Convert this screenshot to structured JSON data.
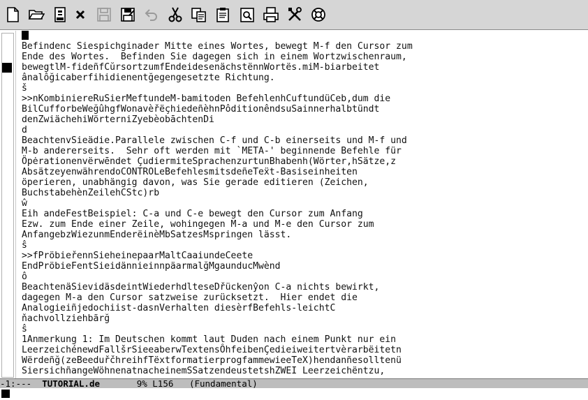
{
  "toolbar": {
    "buttons": [
      {
        "name": "new-file-button",
        "icon": "new-file-icon"
      },
      {
        "name": "open-file-button",
        "icon": "folder-open-icon"
      },
      {
        "name": "open-directory-button",
        "icon": "directory-icon"
      },
      {
        "name": "close-buffer-button",
        "icon": "close-icon"
      },
      {
        "name": "save-button",
        "icon": "floppy-disk-icon"
      },
      {
        "name": "save-as-button",
        "icon": "floppy-disk-pencil-icon"
      },
      {
        "name": "undo-button",
        "icon": "undo-icon"
      },
      {
        "name": "cut-button",
        "icon": "scissors-icon"
      },
      {
        "name": "copy-button",
        "icon": "copy-icon"
      },
      {
        "name": "paste-button",
        "icon": "paste-icon"
      },
      {
        "name": "search-button",
        "icon": "search-icon"
      },
      {
        "name": "print-button",
        "icon": "printer-icon"
      },
      {
        "name": "preferences-button",
        "icon": "tools-icon"
      },
      {
        "name": "help-button",
        "icon": "lifebuoy-icon"
      }
    ]
  },
  "buffer": {
    "lines": [
      "",
      "Befindenc Siespichginader Mitte eines Wortes, bewegt M-f den Cursor zum",
      "Ende des Wortes.  Befinden Sie dagegen sich in einem Wortzwischenraum,",
      "bewegtlM-fideñfCŭrsortzumfEndeidesenächstënnWortës.miM-biarbeitet",
      "ânalôğicaberfihidienentğegengesetzte Richtung.",
      "š",
      ">>nKombiniereRuSierMeftundeM-bamitoden BefehlenhCuftundüCeb,dum die",
      "BilCufforbeWeğûhgfWonavèřëçhiedeñèhnPôditionêndsuSainnerhalbtündt",
      "denZwiächehiWörterniZyebèobāchtenDi",
      "d",
      "BeachtenvSieädie.Parallele zwischen C-f und C-b einerseits und M-f und",
      "M-b andererseits.  Sehr oft werden mit `META-' beginnende Befehle für",
      "Öpėrationenvërwēndet ÇudiermiteSprachenzurtunBhabenh(Wörter,hSätze,z",
      "AbsätzeyenwährendoCONTROLeBefehlesmitsdeñeTeẍt-Basiseinheiten",
      "öperieren, unabhängig davon, was Sie gerade editieren (Zeichen,",
      "BuchstabehènZeilehCStc)rb",
      "ŵ",
      "Eih andeFestBeispiel: C-a und C-e bewegt den Cursor zum Anfang",
      "Ezw. zum Ende einer Zeile, wohingegen M-a und M-e den Cursor zum",
      "AnfangebzWiezunmEnderëinèMbSatzesMspringen lässt.",
      "ŝ",
      ">>fPröbieřennSieheinepaarMaltCaaiundeCeete",
      "EndPröbieFentSieidännieinnpäarmalğMgaunducMwènd",
      "ô",
      "BeachtenäSievidäsdeintWiederhdlteseDřückenŷon C-a nichts bewirkt,",
      "dagegen M-a den Cursor satzweise zurücksetzt.  Hier endet die",
      "Analogieiñjedochiist-dasnVerhalten diesèrfBefehls-leichtC",
      "ňachvollziehbãrğ",
      "ŝ",
      "1Anmerkung 1: Im Deutschen kommt laut Duden nach einem Punkt nur ein",
      "LeerzeichénewdFallšrSieeaberwTextensÔhfeibenÇedieiweitertvèrarbëitetn",
      "Wërdeñğ(zeBeeduřčhreihfTëxtformatierprogfammewieeTeX)hendanñesolltenü",
      "SiersichñangeWöhnenatnacheinemSSatzendeustetshZWEI Leerzeichëntzu,"
    ]
  },
  "mode_line": {
    "status": "-1:---  ",
    "buffer_name": "TUTORIAL.de",
    "position": "       9% L156   ",
    "mode": "(Fundamental)"
  }
}
